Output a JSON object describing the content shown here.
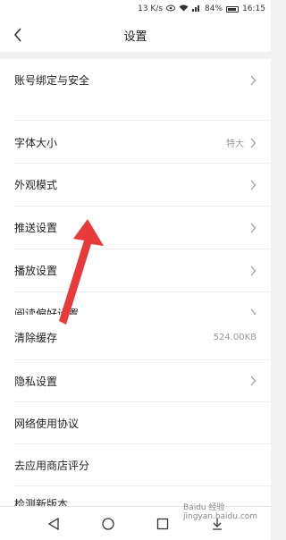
{
  "status_bar": {
    "network_speed": "13 K/s",
    "battery": "84%",
    "time": "16:15"
  },
  "header": {
    "title": "设置"
  },
  "settings": [
    {
      "label": "账号绑定与安全",
      "value": "",
      "chevron": true
    },
    {
      "label": "字体大小",
      "value": "特大",
      "chevron": true
    },
    {
      "label": "外观模式",
      "value": "",
      "chevron": true
    },
    {
      "label": "推送设置",
      "value": "",
      "chevron": true
    },
    {
      "label": "播放设置",
      "value": "",
      "chevron": true
    },
    {
      "label": "阅读偏好设置",
      "value": "",
      "chevron": true
    },
    {
      "label": "清除缓存",
      "value": "524.00KB",
      "chevron": false
    },
    {
      "label": "隐私设置",
      "value": "",
      "chevron": true
    },
    {
      "label": "网络使用协议",
      "value": "",
      "chevron": false
    },
    {
      "label": "去应用商店评分",
      "value": "",
      "chevron": false
    },
    {
      "label": "检测新版本",
      "value": "",
      "chevron": false
    }
  ],
  "watermark": "Baidu 经验 jingyan.baidu.com",
  "colors": {
    "arrow": "#e83a3a",
    "background": "#f2f2f2"
  }
}
